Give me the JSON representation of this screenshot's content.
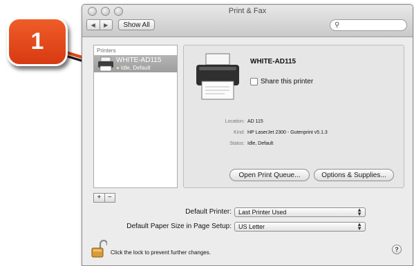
{
  "callout": {
    "number": "1",
    "color": "#e2471b"
  },
  "window": {
    "title": "Print & Fax",
    "nav_back": "◀",
    "nav_forward": "▶",
    "show_all_label": "Show All",
    "search_placeholder": ""
  },
  "printers": {
    "header": "Printers",
    "items": [
      {
        "name": "WHITE-AD115",
        "status": "Idle, Default",
        "selected": true
      }
    ],
    "add_label": "+",
    "remove_label": "−"
  },
  "detail": {
    "name": "WHITE-AD115",
    "share_label": "Share this printer",
    "share_checked": false,
    "location_key": "Location:",
    "location_value": "AD 115",
    "kind_key": "Kind:",
    "kind_value": "HP LaserJet 2300 - Gutenprint v5.1.3",
    "status_key": "Status:",
    "status_value": "Idle, Default",
    "open_queue_label": "Open Print Queue...",
    "options_label": "Options & Supplies..."
  },
  "defaults": {
    "default_printer_label": "Default Printer:",
    "default_printer_value": "Last Printer Used",
    "paper_size_label": "Default Paper Size in Page Setup:",
    "paper_size_value": "US Letter"
  },
  "footer": {
    "lock_text": "Click the lock to prevent further changes.",
    "help_label": "?"
  }
}
